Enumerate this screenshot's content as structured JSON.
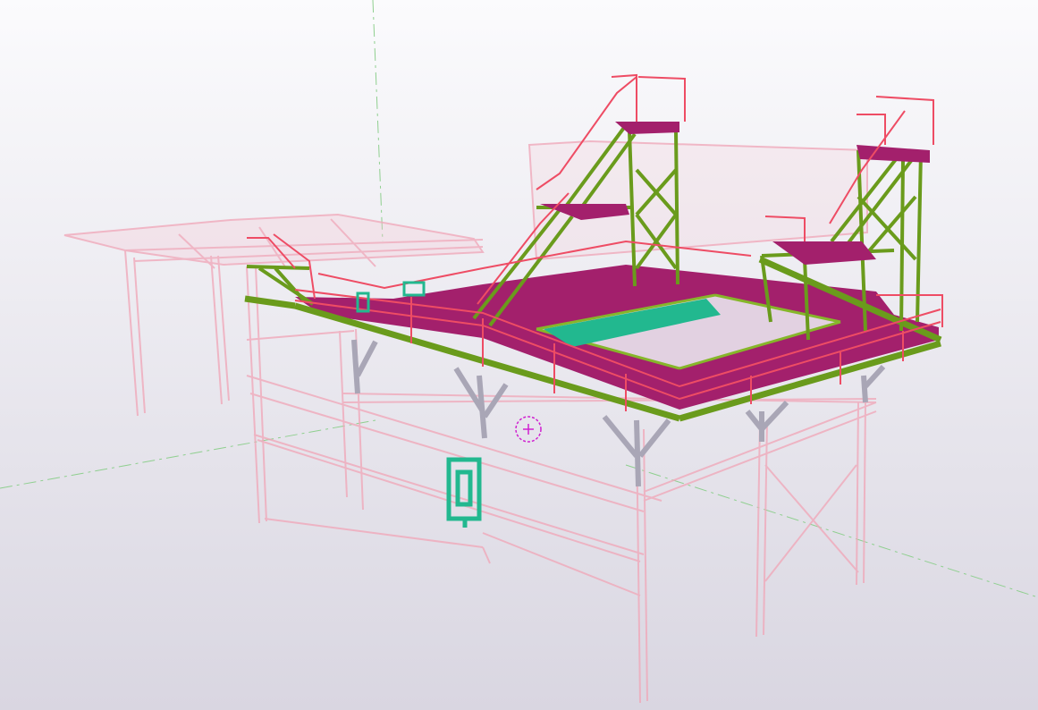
{
  "viewport": {
    "background_top": "#fbfbfd",
    "background_bottom": "#d9d6e1"
  },
  "colors": {
    "ghost_structure": "#f0a9ba",
    "ghost_fill": "#f5c4d0",
    "handrail": "#ee4c64",
    "deck_plate": "#a3206c",
    "beam": "#6a9b1c",
    "beam_light": "#86b62a",
    "column_support": "#a9a6b6",
    "secondary_steel": "#22b88f",
    "work_plane_axis": "#8fcf8f",
    "selection_marker": "#d020d0"
  },
  "icons": {
    "selection_marker": "view-rotation-point-icon"
  }
}
